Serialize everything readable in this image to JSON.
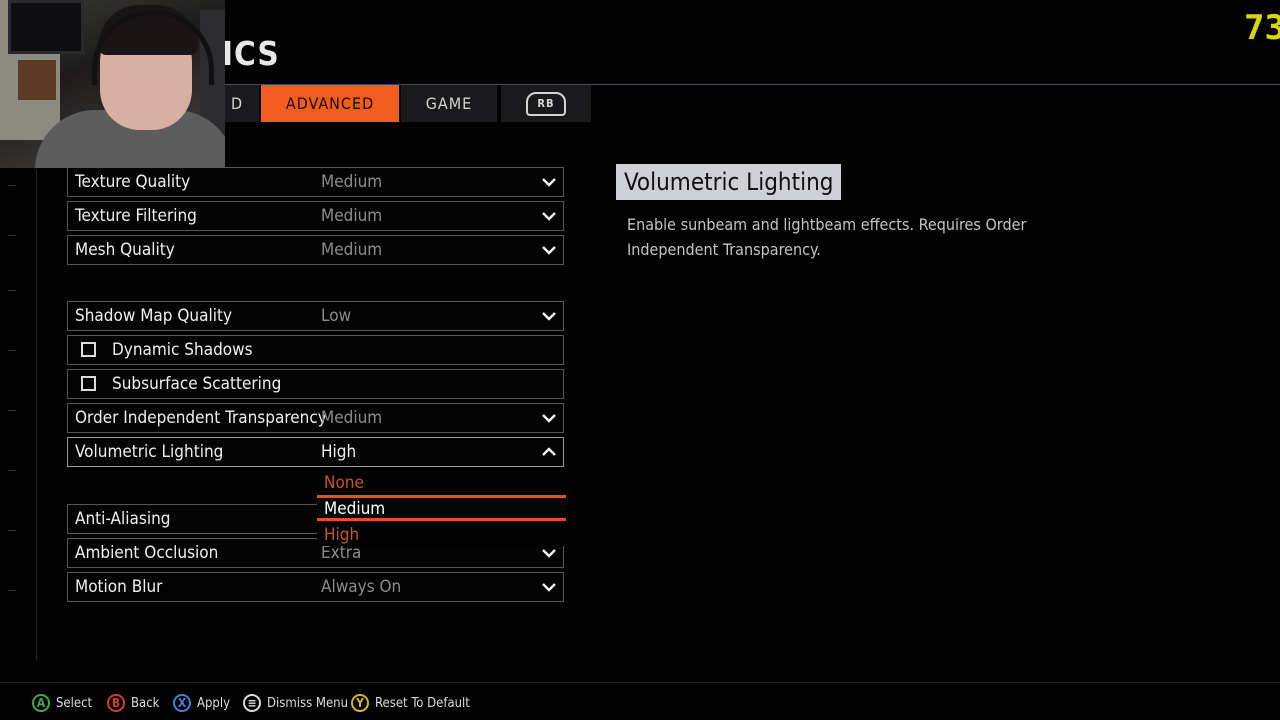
{
  "header": {
    "title_fragment": "ICS",
    "fps": "73"
  },
  "tabs": [
    {
      "label": "D"
    },
    {
      "label": "ADVANCED"
    },
    {
      "label": "GAME"
    },
    {
      "label": "RB"
    }
  ],
  "settings": [
    {
      "label": "Texture Quality",
      "value": "Medium",
      "type": "dropdown"
    },
    {
      "label": "Texture Filtering",
      "value": "Medium",
      "type": "dropdown"
    },
    {
      "label": "Mesh Quality",
      "value": "Medium",
      "type": "dropdown"
    },
    {
      "label": "Shadow Map Quality",
      "value": "Low",
      "type": "dropdown"
    },
    {
      "label": "Dynamic Shadows",
      "checked": false,
      "type": "checkbox"
    },
    {
      "label": "Subsurface Scattering",
      "checked": false,
      "type": "checkbox"
    },
    {
      "label": "Order Independent Transparency",
      "value": "Medium",
      "type": "dropdown"
    },
    {
      "label": "Volumetric Lighting",
      "value": "High",
      "type": "dropdown",
      "open": true
    },
    {
      "label": "Anti-Aliasing",
      "value": "",
      "type": "dropdown"
    },
    {
      "label": "Ambient Occlusion",
      "value": "Extra",
      "type": "dropdown"
    },
    {
      "label": "Motion Blur",
      "value": "Always On",
      "type": "dropdown"
    }
  ],
  "dropdown": {
    "options": [
      "None",
      "Medium",
      "High"
    ],
    "highlighted": "Medium"
  },
  "description": {
    "title": "Volumetric Lighting",
    "text": "Enable sunbeam and lightbeam effects. Requires Order Independent Transparency."
  },
  "footer": [
    {
      "button": "A",
      "label": "Select"
    },
    {
      "button": "B",
      "label": "Back"
    },
    {
      "button": "X",
      "label": "Apply"
    },
    {
      "button": "≡",
      "label": "Dismiss Menu"
    },
    {
      "button": "Y",
      "label": "Reset To Default"
    }
  ],
  "colors": {
    "accent": "#f25c1c",
    "background": "#020203",
    "fps": "#d6d800"
  }
}
